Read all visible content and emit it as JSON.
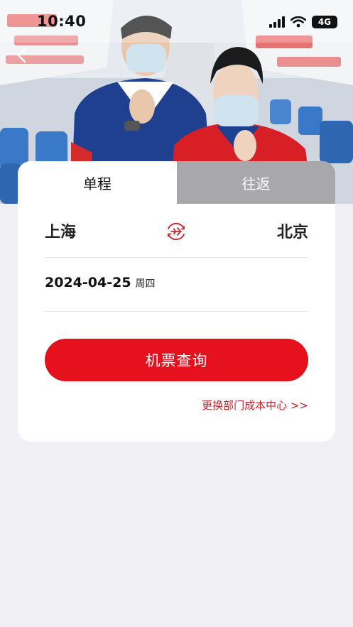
{
  "status_bar": {
    "time": "10:40",
    "network": "4G",
    "icons": [
      "signal-icon",
      "wifi-icon",
      "battery-icon"
    ]
  },
  "nav": {
    "back_icon": "chevron-left-icon"
  },
  "hero": {
    "description": "flight-attendants-photo"
  },
  "tabs": [
    {
      "label": "单程",
      "active": true
    },
    {
      "label": "往返",
      "active": false
    }
  ],
  "route": {
    "from": "上海",
    "to": "北京",
    "swap_icon": "plane-icon"
  },
  "date": {
    "value": "2024-04-25",
    "weekday": "周四"
  },
  "search_button": {
    "label": "机票查询"
  },
  "cost_center_link": {
    "label": "更换部门成本中心 >>"
  },
  "colors": {
    "primary_red": "#e5111d",
    "link_red": "#c8232a",
    "page_bg": "#efeff4"
  }
}
